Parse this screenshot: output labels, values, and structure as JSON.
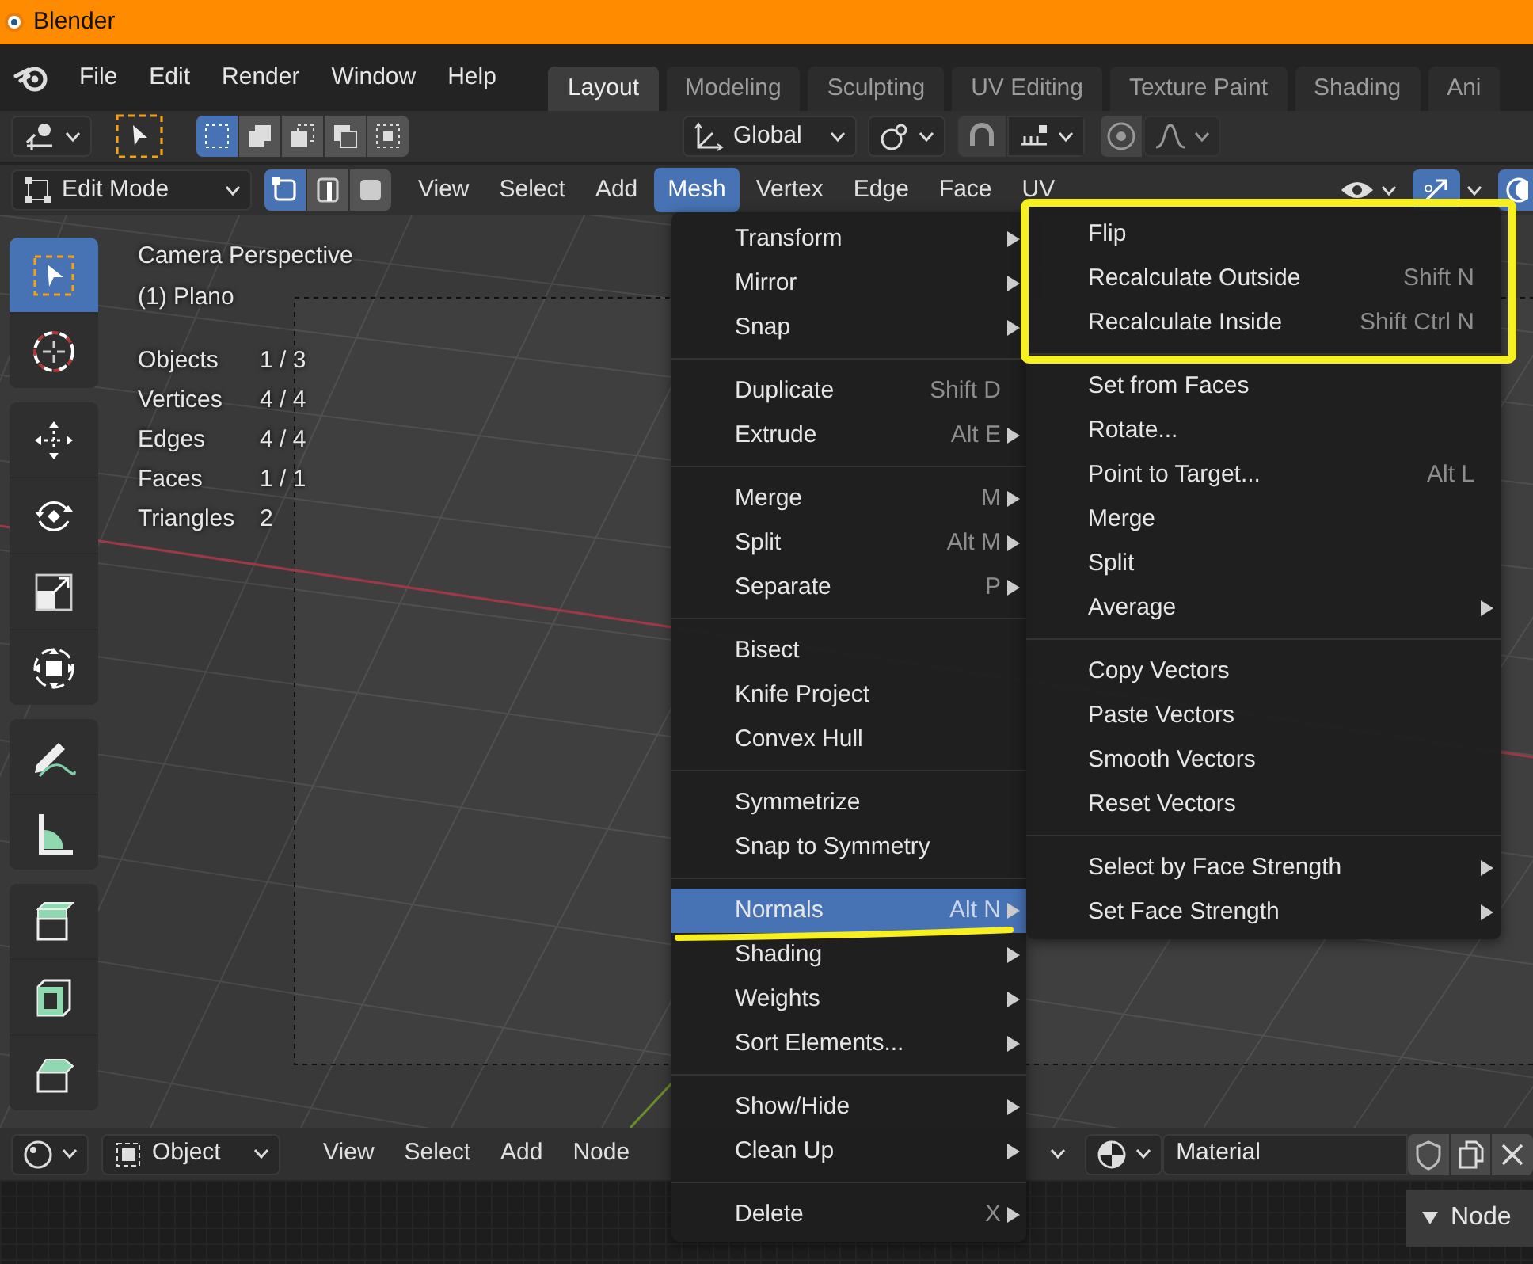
{
  "window": {
    "title": "Blender"
  },
  "menubar": {
    "items": [
      "File",
      "Edit",
      "Render",
      "Window",
      "Help"
    ]
  },
  "workspace_tabs": [
    {
      "label": "Layout",
      "selected": true
    },
    {
      "label": "Modeling",
      "selected": false
    },
    {
      "label": "Sculpting",
      "selected": false
    },
    {
      "label": "UV Editing",
      "selected": false
    },
    {
      "label": "Texture Paint",
      "selected": false
    },
    {
      "label": "Shading",
      "selected": false
    },
    {
      "label": "Ani",
      "selected": false
    }
  ],
  "tool_header": {
    "select_modes": [
      {
        "selected": true
      },
      {
        "selected": false
      },
      {
        "selected": false
      },
      {
        "selected": false
      },
      {
        "selected": false
      }
    ],
    "orientation": "Global"
  },
  "editor_header": {
    "mode": "Edit Mode",
    "select_modes": [
      {
        "selected": true
      },
      {
        "selected": false
      },
      {
        "selected": false
      }
    ],
    "menus": [
      {
        "label": "View",
        "selected": false
      },
      {
        "label": "Select",
        "selected": false
      },
      {
        "label": "Add",
        "selected": false
      },
      {
        "label": "Mesh",
        "selected": true
      },
      {
        "label": "Vertex",
        "selected": false
      },
      {
        "label": "Edge",
        "selected": false
      },
      {
        "label": "Face",
        "selected": false
      },
      {
        "label": "UV",
        "selected": false
      }
    ]
  },
  "toolbar": [
    [
      {
        "kind": "select",
        "selected": true
      },
      {
        "kind": "cursor",
        "selected": false
      }
    ],
    [
      {
        "kind": "move",
        "selected": false
      },
      {
        "kind": "rotate",
        "selected": false
      },
      {
        "kind": "scale",
        "selected": false
      },
      {
        "kind": "transform",
        "selected": false
      }
    ],
    [
      {
        "kind": "annotate",
        "selected": false
      },
      {
        "kind": "measure",
        "selected": false
      }
    ],
    [
      {
        "kind": "extrude",
        "selected": false
      },
      {
        "kind": "inset",
        "selected": false
      },
      {
        "kind": "bevel",
        "selected": false
      }
    ]
  ],
  "overlay_info": {
    "lines": [
      "Camera Perspective",
      "(1) Plano"
    ],
    "stats": [
      {
        "label": "Objects",
        "value": "1 / 3"
      },
      {
        "label": "Vertices",
        "value": "4 / 4"
      },
      {
        "label": "Edges",
        "value": "4 / 4"
      },
      {
        "label": "Faces",
        "value": "1 / 1"
      },
      {
        "label": "Triangles",
        "value": "2"
      }
    ]
  },
  "mesh_menu": {
    "groups": [
      [
        {
          "label": "Transform",
          "submenu": true,
          "selected": false
        },
        {
          "label": "Mirror",
          "submenu": true,
          "selected": false
        },
        {
          "label": "Snap",
          "submenu": true,
          "selected": false
        }
      ],
      [
        {
          "label": "Duplicate",
          "shortcut": "Shift D",
          "submenu": false,
          "selected": false
        },
        {
          "label": "Extrude",
          "shortcut": "Alt E",
          "submenu": true,
          "selected": false
        }
      ],
      [
        {
          "label": "Merge",
          "shortcut": "M",
          "submenu": true,
          "selected": false
        },
        {
          "label": "Split",
          "shortcut": "Alt M",
          "submenu": true,
          "selected": false
        },
        {
          "label": "Separate",
          "shortcut": "P",
          "submenu": true,
          "selected": false
        }
      ],
      [
        {
          "label": "Bisect",
          "submenu": false,
          "selected": false
        },
        {
          "label": "Knife Project",
          "submenu": false,
          "selected": false
        },
        {
          "label": "Convex Hull",
          "submenu": false,
          "selected": false
        }
      ],
      [
        {
          "label": "Symmetrize",
          "submenu": false,
          "selected": false
        },
        {
          "label": "Snap to Symmetry",
          "submenu": false,
          "selected": false
        }
      ],
      [
        {
          "label": "Normals",
          "shortcut": "Alt N",
          "submenu": true,
          "selected": true
        },
        {
          "label": "Shading",
          "submenu": true,
          "selected": false
        },
        {
          "label": "Weights",
          "submenu": true,
          "selected": false
        },
        {
          "label": "Sort Elements...",
          "submenu": true,
          "selected": false
        }
      ],
      [
        {
          "label": "Show/Hide",
          "submenu": true,
          "selected": false
        },
        {
          "label": "Clean Up",
          "submenu": true,
          "selected": false
        }
      ],
      [
        {
          "label": "Delete",
          "shortcut": "X",
          "submenu": true,
          "selected": false
        }
      ]
    ]
  },
  "normals_submenu": {
    "groups": [
      [
        {
          "label": "Flip",
          "submenu": false,
          "selected": false
        },
        {
          "label": "Recalculate Outside",
          "shortcut": "Shift N",
          "submenu": false,
          "selected": false
        },
        {
          "label": "Recalculate Inside",
          "shortcut": "Shift Ctrl N",
          "submenu": false,
          "selected": false
        }
      ],
      [
        {
          "label": "Set from Faces",
          "submenu": false,
          "selected": false
        },
        {
          "label": "Rotate...",
          "submenu": false,
          "selected": false
        },
        {
          "label": "Point to Target...",
          "shortcut": "Alt L",
          "submenu": false,
          "selected": false
        },
        {
          "label": "Merge",
          "submenu": false,
          "selected": false
        },
        {
          "label": "Split",
          "submenu": false,
          "selected": false
        },
        {
          "label": "Average",
          "submenu": true,
          "selected": false
        }
      ],
      [
        {
          "label": "Copy Vectors",
          "submenu": false,
          "selected": false
        },
        {
          "label": "Paste Vectors",
          "submenu": false,
          "selected": false
        },
        {
          "label": "Smooth Vectors",
          "submenu": false,
          "selected": false
        },
        {
          "label": "Reset Vectors",
          "submenu": false,
          "selected": false
        }
      ],
      [
        {
          "label": "Select by Face Strength",
          "submenu": true,
          "selected": false
        },
        {
          "label": "Set Face Strength",
          "submenu": true,
          "selected": false
        }
      ]
    ]
  },
  "node_header": {
    "editor": "Object",
    "menus": [
      "View",
      "Select",
      "Add",
      "Node"
    ],
    "material": "Material"
  },
  "sidebar_panel": {
    "title": "Node",
    "expanded": true
  },
  "annotations": {
    "box": true,
    "underline": true
  }
}
